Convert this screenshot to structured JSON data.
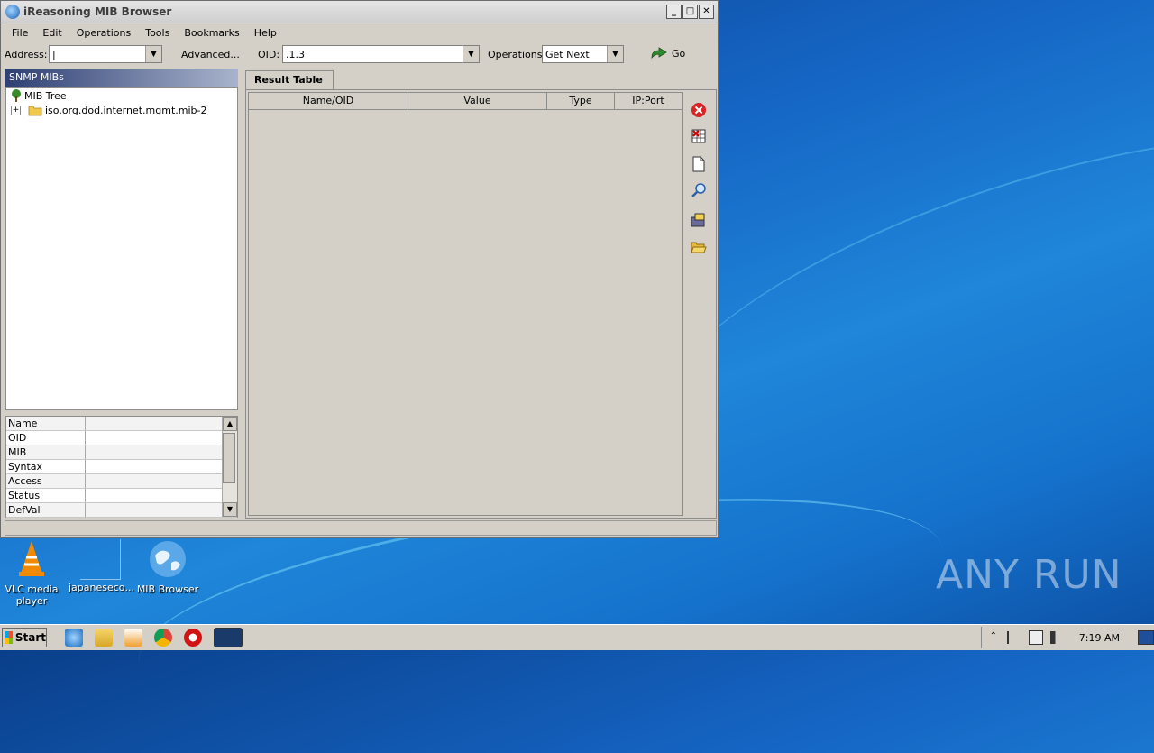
{
  "window": {
    "title": "iReasoning MIB Browser",
    "btns": [
      "_",
      "□",
      "✕"
    ]
  },
  "menu": [
    "File",
    "Edit",
    "Operations",
    "Tools",
    "Bookmarks",
    "Help"
  ],
  "toolbar": {
    "address_label": "Address:",
    "address_value": "|",
    "advanced_label": "Advanced...",
    "oid_label": "OID:",
    "oid_value": ".1.3",
    "operations_label": "Operations:",
    "operations_value": "Get Next",
    "go_label": "Go"
  },
  "left_panel": {
    "title": "SNMP MIBs",
    "tree_root": "MIB Tree",
    "tree_child": "iso.org.dod.internet.mgmt.mib-2",
    "props": [
      "Name",
      "OID",
      "MIB",
      "Syntax",
      "Access",
      "Status",
      "DefVal"
    ]
  },
  "result": {
    "tab": "Result Table",
    "columns": [
      "Name/OID",
      "Value",
      "Type",
      "IP:Port"
    ]
  },
  "desktop": {
    "icons": [
      "VLC media player",
      "japanesecо...",
      "MIB Browser"
    ],
    "watermark": "ANY RUN"
  },
  "taskbar": {
    "start": "Start",
    "clock": "7:19 AM"
  },
  "colors": {
    "panel_head": "#2e3f73",
    "go_arrow": "#2e8b2e",
    "desktop": "#1565c4"
  }
}
